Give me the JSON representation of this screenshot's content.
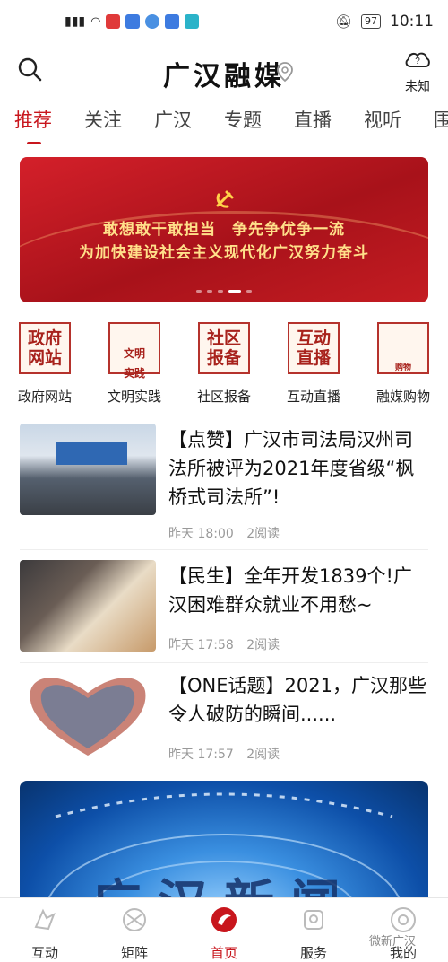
{
  "status": {
    "time": "10:11",
    "battery": "97"
  },
  "header": {
    "title": "广汉融媒",
    "weather_label": "未知"
  },
  "tabs": [
    "推荐",
    "关注",
    "广汉",
    "专题",
    "直播",
    "视听",
    "围堆堆"
  ],
  "banner": {
    "line1": "敢想敢干敢担当　争先争优争一流",
    "line2": "为加快建设社会主义现代化广汉努力奋斗"
  },
  "quick_links": [
    {
      "icon_text": "政府\n网站",
      "label": "政府网站",
      "icon": "gov-site-icon"
    },
    {
      "icon_text": "文明\n实践",
      "label": "文明实践",
      "icon": "civilization-icon"
    },
    {
      "icon_text": "社区\n报备",
      "label": "社区报备",
      "icon": "community-report-icon"
    },
    {
      "icon_text": "互动\n直播",
      "label": "互动直播",
      "icon": "live-interaction-icon"
    },
    {
      "icon_text": "购物",
      "label": "融媒购物",
      "icon": "shopping-cart-icon"
    }
  ],
  "articles": [
    {
      "title": "【点赞】广汉市司法局汉州司法所被评为2021年度省级“枫桥式司法所”!",
      "time": "昨天 18:00",
      "reads": "2阅读"
    },
    {
      "title": "【民生】全年开发1839个!广汉困难群众就业不用愁~",
      "time": "昨天 17:58",
      "reads": "2阅读"
    },
    {
      "title": "【ONE话题】2021，广汉那些令人破防的瞬间......",
      "time": "昨天 17:57",
      "reads": "2阅读"
    }
  ],
  "video": {
    "title": "广汉新闻"
  },
  "bottom_nav": [
    {
      "label": "互动",
      "icon": "interaction-icon"
    },
    {
      "label": "矩阵",
      "icon": "matrix-icon"
    },
    {
      "label": "首页",
      "icon": "home-icon"
    },
    {
      "label": "服务",
      "icon": "service-icon"
    },
    {
      "label": "我的",
      "icon": "profile-icon"
    }
  ],
  "watermark": "微新广汉",
  "colors": {
    "accent": "#c8161d"
  }
}
